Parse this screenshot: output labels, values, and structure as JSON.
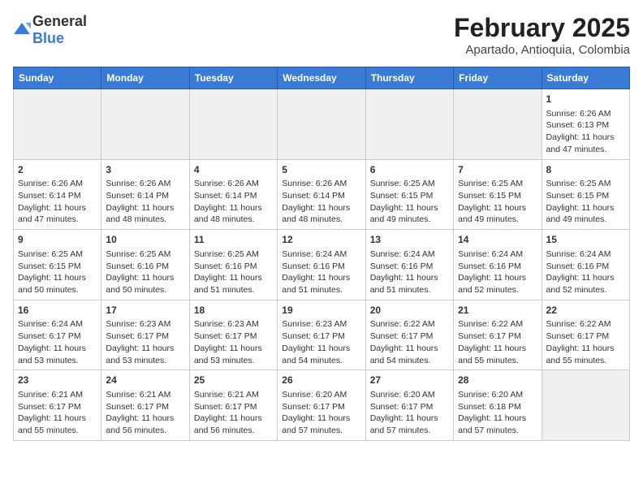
{
  "header": {
    "logo_general": "General",
    "logo_blue": "Blue",
    "month_year": "February 2025",
    "location": "Apartado, Antioquia, Colombia"
  },
  "days_of_week": [
    "Sunday",
    "Monday",
    "Tuesday",
    "Wednesday",
    "Thursday",
    "Friday",
    "Saturday"
  ],
  "weeks": [
    [
      {
        "day": "",
        "empty": true
      },
      {
        "day": "",
        "empty": true
      },
      {
        "day": "",
        "empty": true
      },
      {
        "day": "",
        "empty": true
      },
      {
        "day": "",
        "empty": true
      },
      {
        "day": "",
        "empty": true
      },
      {
        "day": "1",
        "sunrise": "Sunrise: 6:26 AM",
        "sunset": "Sunset: 6:13 PM",
        "daylight": "Daylight: 11 hours and 47 minutes."
      }
    ],
    [
      {
        "day": "2",
        "sunrise": "Sunrise: 6:26 AM",
        "sunset": "Sunset: 6:14 PM",
        "daylight": "Daylight: 11 hours and 47 minutes."
      },
      {
        "day": "3",
        "sunrise": "Sunrise: 6:26 AM",
        "sunset": "Sunset: 6:14 PM",
        "daylight": "Daylight: 11 hours and 48 minutes."
      },
      {
        "day": "4",
        "sunrise": "Sunrise: 6:26 AM",
        "sunset": "Sunset: 6:14 PM",
        "daylight": "Daylight: 11 hours and 48 minutes."
      },
      {
        "day": "5",
        "sunrise": "Sunrise: 6:26 AM",
        "sunset": "Sunset: 6:14 PM",
        "daylight": "Daylight: 11 hours and 48 minutes."
      },
      {
        "day": "6",
        "sunrise": "Sunrise: 6:25 AM",
        "sunset": "Sunset: 6:15 PM",
        "daylight": "Daylight: 11 hours and 49 minutes."
      },
      {
        "day": "7",
        "sunrise": "Sunrise: 6:25 AM",
        "sunset": "Sunset: 6:15 PM",
        "daylight": "Daylight: 11 hours and 49 minutes."
      },
      {
        "day": "8",
        "sunrise": "Sunrise: 6:25 AM",
        "sunset": "Sunset: 6:15 PM",
        "daylight": "Daylight: 11 hours and 49 minutes."
      }
    ],
    [
      {
        "day": "9",
        "sunrise": "Sunrise: 6:25 AM",
        "sunset": "Sunset: 6:15 PM",
        "daylight": "Daylight: 11 hours and 50 minutes."
      },
      {
        "day": "10",
        "sunrise": "Sunrise: 6:25 AM",
        "sunset": "Sunset: 6:16 PM",
        "daylight": "Daylight: 11 hours and 50 minutes."
      },
      {
        "day": "11",
        "sunrise": "Sunrise: 6:25 AM",
        "sunset": "Sunset: 6:16 PM",
        "daylight": "Daylight: 11 hours and 51 minutes."
      },
      {
        "day": "12",
        "sunrise": "Sunrise: 6:24 AM",
        "sunset": "Sunset: 6:16 PM",
        "daylight": "Daylight: 11 hours and 51 minutes."
      },
      {
        "day": "13",
        "sunrise": "Sunrise: 6:24 AM",
        "sunset": "Sunset: 6:16 PM",
        "daylight": "Daylight: 11 hours and 51 minutes."
      },
      {
        "day": "14",
        "sunrise": "Sunrise: 6:24 AM",
        "sunset": "Sunset: 6:16 PM",
        "daylight": "Daylight: 11 hours and 52 minutes."
      },
      {
        "day": "15",
        "sunrise": "Sunrise: 6:24 AM",
        "sunset": "Sunset: 6:16 PM",
        "daylight": "Daylight: 11 hours and 52 minutes."
      }
    ],
    [
      {
        "day": "16",
        "sunrise": "Sunrise: 6:24 AM",
        "sunset": "Sunset: 6:17 PM",
        "daylight": "Daylight: 11 hours and 53 minutes."
      },
      {
        "day": "17",
        "sunrise": "Sunrise: 6:23 AM",
        "sunset": "Sunset: 6:17 PM",
        "daylight": "Daylight: 11 hours and 53 minutes."
      },
      {
        "day": "18",
        "sunrise": "Sunrise: 6:23 AM",
        "sunset": "Sunset: 6:17 PM",
        "daylight": "Daylight: 11 hours and 53 minutes."
      },
      {
        "day": "19",
        "sunrise": "Sunrise: 6:23 AM",
        "sunset": "Sunset: 6:17 PM",
        "daylight": "Daylight: 11 hours and 54 minutes."
      },
      {
        "day": "20",
        "sunrise": "Sunrise: 6:22 AM",
        "sunset": "Sunset: 6:17 PM",
        "daylight": "Daylight: 11 hours and 54 minutes."
      },
      {
        "day": "21",
        "sunrise": "Sunrise: 6:22 AM",
        "sunset": "Sunset: 6:17 PM",
        "daylight": "Daylight: 11 hours and 55 minutes."
      },
      {
        "day": "22",
        "sunrise": "Sunrise: 6:22 AM",
        "sunset": "Sunset: 6:17 PM",
        "daylight": "Daylight: 11 hours and 55 minutes."
      }
    ],
    [
      {
        "day": "23",
        "sunrise": "Sunrise: 6:21 AM",
        "sunset": "Sunset: 6:17 PM",
        "daylight": "Daylight: 11 hours and 55 minutes."
      },
      {
        "day": "24",
        "sunrise": "Sunrise: 6:21 AM",
        "sunset": "Sunset: 6:17 PM",
        "daylight": "Daylight: 11 hours and 56 minutes."
      },
      {
        "day": "25",
        "sunrise": "Sunrise: 6:21 AM",
        "sunset": "Sunset: 6:17 PM",
        "daylight": "Daylight: 11 hours and 56 minutes."
      },
      {
        "day": "26",
        "sunrise": "Sunrise: 6:20 AM",
        "sunset": "Sunset: 6:17 PM",
        "daylight": "Daylight: 11 hours and 57 minutes."
      },
      {
        "day": "27",
        "sunrise": "Sunrise: 6:20 AM",
        "sunset": "Sunset: 6:17 PM",
        "daylight": "Daylight: 11 hours and 57 minutes."
      },
      {
        "day": "28",
        "sunrise": "Sunrise: 6:20 AM",
        "sunset": "Sunset: 6:18 PM",
        "daylight": "Daylight: 11 hours and 57 minutes."
      },
      {
        "day": "",
        "empty": true
      }
    ]
  ]
}
